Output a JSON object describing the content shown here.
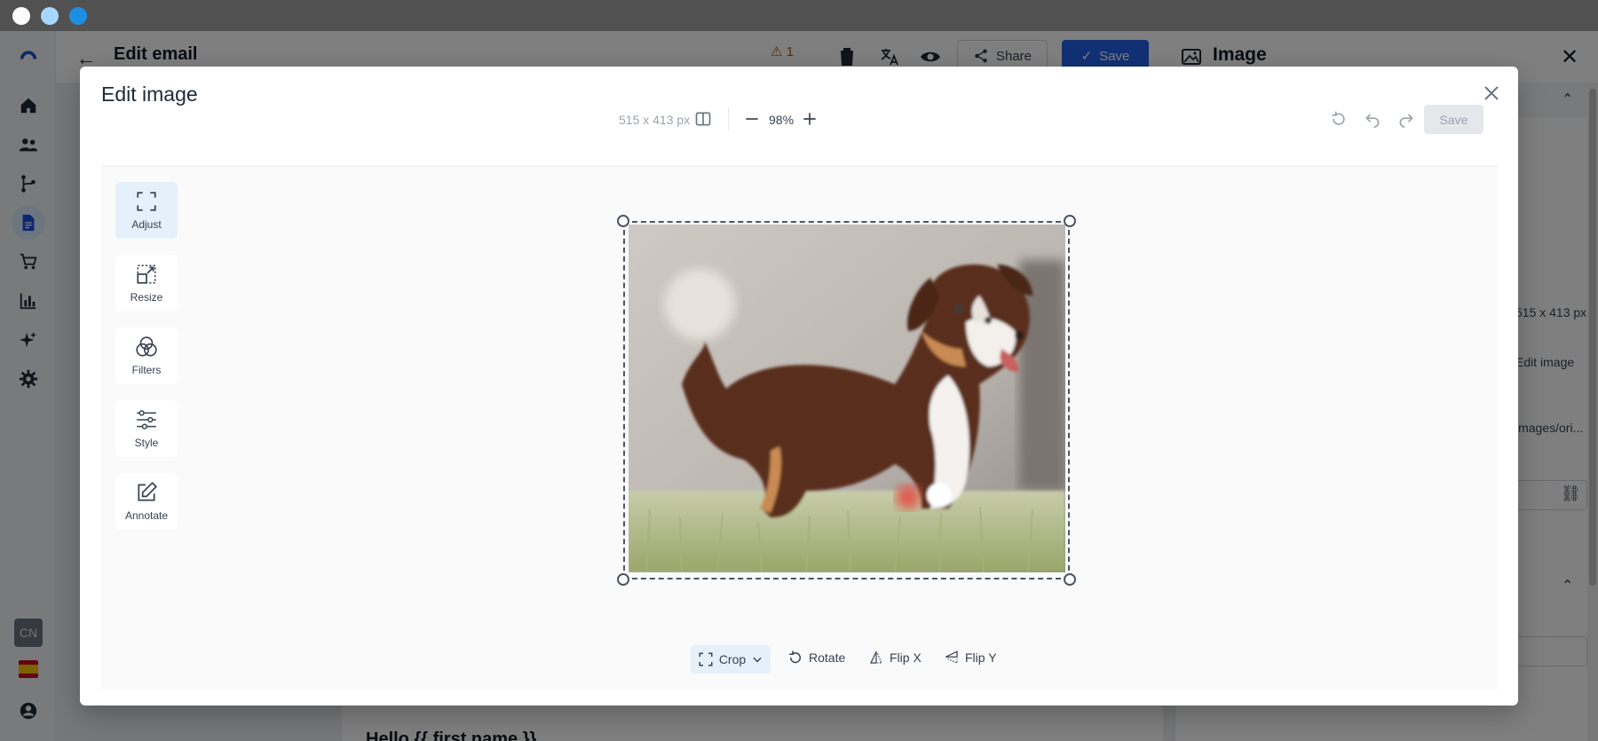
{
  "app": {
    "page_title": "Edit email",
    "warning_count": "1",
    "share_label": "Share",
    "save_label": "Save",
    "panel_title": "Image",
    "panel_dims": "515 x 413 px",
    "panel_edit_image": "Edit image",
    "panel_path": "images/ori...",
    "email_heading": "Hello {{ first.name }}",
    "language_badge": "CN"
  },
  "modal": {
    "title": "Edit image",
    "toolbar": {
      "dimensions": "515 x 413 px",
      "zoom": "98%",
      "save_label": "Save"
    },
    "tools": [
      {
        "label": "Adjust",
        "icon": "expand-corners-icon",
        "active": true
      },
      {
        "label": "Resize",
        "icon": "resize-icon",
        "active": false
      },
      {
        "label": "Filters",
        "icon": "filters-icon",
        "active": false
      },
      {
        "label": "Style",
        "icon": "sliders-icon",
        "active": false
      },
      {
        "label": "Annotate",
        "icon": "annotate-pencil-icon",
        "active": false
      }
    ],
    "bottom_tools": {
      "crop": "Crop",
      "rotate": "Rotate",
      "flip_x": "Flip X",
      "flip_y": "Flip Y"
    }
  },
  "colors": {
    "primary": "#2563eb",
    "active_tool_bg": "#e6f0fb",
    "warning": "#b45309",
    "os_dot_1": "#ffffff",
    "os_dot_2": "#a5d8ff",
    "os_dot_3": "#1c8fe3"
  }
}
